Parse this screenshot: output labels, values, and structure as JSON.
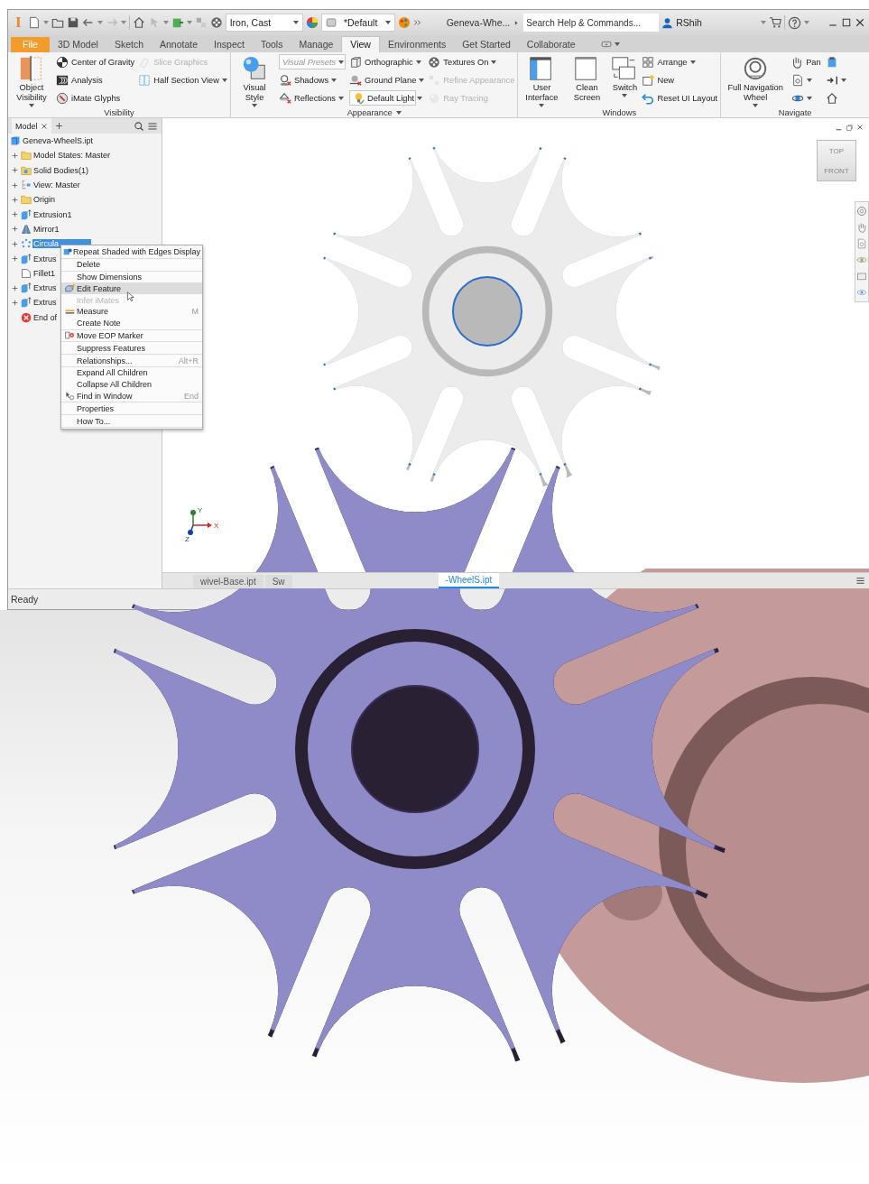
{
  "title_bar": {
    "logo": "I",
    "material": "Iron, Cast",
    "appearance": "*Default",
    "document": "Geneva-Whe...",
    "search": {
      "placeholder": "Search Help & Commands..."
    },
    "user": "RShih"
  },
  "ribbon_tabs": [
    {
      "label": "File",
      "kind": "file",
      "selected": false
    },
    {
      "label": "3D Model",
      "kind": "tab",
      "selected": false
    },
    {
      "label": "Sketch",
      "kind": "tab",
      "selected": false
    },
    {
      "label": "Annotate",
      "kind": "tab",
      "selected": false
    },
    {
      "label": "Inspect",
      "kind": "tab",
      "selected": false
    },
    {
      "label": "Tools",
      "kind": "tab",
      "selected": false
    },
    {
      "label": "Manage",
      "kind": "tab",
      "selected": false
    },
    {
      "label": "View",
      "kind": "tab",
      "selected": true
    },
    {
      "label": "Environments",
      "kind": "tab",
      "selected": false
    },
    {
      "label": "Get Started",
      "kind": "tab",
      "selected": false
    },
    {
      "label": "Collaborate",
      "kind": "tab",
      "selected": false
    }
  ],
  "ribbon_panels": [
    {
      "title": "Visibility",
      "title_dropdown": false,
      "columns": [
        [
          {
            "kind": "large",
            "label": "Object Visibility",
            "dropdown": true,
            "disabled": false
          }
        ],
        [
          {
            "kind": "small",
            "label": "Center of Gravity",
            "dropdown": false,
            "disabled": false
          },
          {
            "kind": "small",
            "label": "Analysis",
            "dropdown": false,
            "disabled": false
          },
          {
            "kind": "small",
            "label": "iMate Glyphs",
            "dropdown": false,
            "disabled": false
          }
        ],
        [
          {
            "kind": "small",
            "label": "Slice Graphics",
            "dropdown": false,
            "disabled": true
          },
          {
            "kind": "small",
            "label": "Half Section View",
            "dropdown": true,
            "disabled": false
          }
        ]
      ]
    },
    {
      "title": "Appearance",
      "title_dropdown": true,
      "columns": [
        [
          {
            "kind": "large",
            "label": "Visual Style",
            "dropdown": true,
            "disabled": false
          }
        ],
        [
          {
            "kind": "combo",
            "placeholder": "Visual Presets"
          },
          {
            "kind": "small",
            "label": "Shadows",
            "dropdown": true,
            "disabled": false
          },
          {
            "kind": "small",
            "label": "Reflections",
            "dropdown": true,
            "disabled": false
          }
        ],
        [
          {
            "kind": "small",
            "label": "Orthographic",
            "dropdown": true,
            "disabled": false
          },
          {
            "kind": "small",
            "label": "Ground Plane",
            "dropdown": true,
            "disabled": false
          },
          {
            "kind": "combo",
            "value": "Default Light"
          }
        ],
        [
          {
            "kind": "small",
            "label": "Textures On",
            "dropdown": true,
            "disabled": false
          },
          {
            "kind": "small",
            "label": "Refine Appearance",
            "dropdown": false,
            "disabled": true
          },
          {
            "kind": "small",
            "label": "Ray Tracing",
            "dropdown": false,
            "disabled": true
          }
        ]
      ]
    },
    {
      "title": "Windows",
      "title_dropdown": false,
      "columns": [
        [
          {
            "kind": "large",
            "label": "User Interface",
            "dropdown": true,
            "disabled": false
          }
        ],
        [
          {
            "kind": "large",
            "label": "Clean Screen",
            "dropdown": false,
            "disabled": false
          }
        ],
        [
          {
            "kind": "large",
            "label": "Switch",
            "dropdown": true,
            "disabled": false
          }
        ],
        [
          {
            "kind": "small",
            "label": "Arrange",
            "dropdown": true,
            "disabled": false
          },
          {
            "kind": "small",
            "label": "New",
            "dropdown": false,
            "disabled": false
          },
          {
            "kind": "small",
            "label": "Reset UI Layout",
            "dropdown": false,
            "disabled": false
          }
        ]
      ]
    },
    {
      "title": "Navigate",
      "title_dropdown": false,
      "columns": [
        [
          {
            "kind": "large",
            "label": "Full Navigation Wheel",
            "dropdown": true,
            "disabled": false
          }
        ],
        [
          {
            "kind": "small",
            "label": "Pan",
            "dropdown": false,
            "disabled": false
          },
          {
            "kind": "icon",
            "dropdown": true,
            "disabled": false
          },
          {
            "kind": "icon",
            "dropdown": true,
            "disabled": false
          }
        ],
        [
          {
            "kind": "icon",
            "dropdown": false,
            "disabled": false
          },
          {
            "kind": "icon",
            "dropdown": true,
            "disabled": false
          },
          {
            "kind": "icon",
            "dropdown": false,
            "disabled": false
          }
        ]
      ]
    }
  ],
  "browser": {
    "tab": "Model",
    "root": {
      "label": "Geneva-WheelS.ipt",
      "children": [
        {
          "label": "Model States: Master",
          "kind": "node",
          "selected": false
        },
        {
          "label": "Solid Bodies(1)",
          "kind": "node",
          "selected": false
        },
        {
          "label": "View: Master",
          "kind": "node",
          "selected": false
        },
        {
          "label": "Origin",
          "kind": "node",
          "selected": false
        },
        {
          "label": "Extrusion1",
          "kind": "node",
          "selected": false
        },
        {
          "label": "Mirror1",
          "kind": "node",
          "selected": false
        },
        {
          "label": "Circula",
          "kind": "node",
          "selected": true
        },
        {
          "label": "Extrus",
          "kind": "node",
          "selected": false
        },
        {
          "label": "Fillet1",
          "kind": "leaf",
          "selected": false
        },
        {
          "label": "Extrus",
          "kind": "node",
          "selected": false
        },
        {
          "label": "Extrus",
          "kind": "node",
          "selected": false
        },
        {
          "label": "End of",
          "kind": "leaf",
          "selected": false
        }
      ]
    }
  },
  "context_menu": {
    "groups": [
      [
        {
          "label": "Repeat Shaded with Edges Display",
          "selected": false,
          "disabled": false
        }
      ],
      [
        {
          "label": "Delete",
          "selected": false,
          "disabled": false
        }
      ],
      [
        {
          "label": "Show Dimensions",
          "selected": false,
          "disabled": false
        },
        {
          "label": "Edit Feature",
          "selected": true,
          "disabled": false
        },
        {
          "label": "Infer iMates",
          "selected": false,
          "disabled": true
        },
        {
          "label": "Measure",
          "shortcut": "M",
          "selected": false,
          "disabled": false
        },
        {
          "label": "Create Note",
          "selected": false,
          "disabled": false
        }
      ],
      [
        {
          "label": "Move EOP Marker",
          "selected": false,
          "disabled": false
        }
      ],
      [
        {
          "label": "Suppress Features",
          "selected": false,
          "disabled": false
        }
      ],
      [
        {
          "label": "Relationships...",
          "shortcut": "Alt+R",
          "selected": false,
          "disabled": false
        }
      ],
      [
        {
          "label": "Expand All Children",
          "selected": false,
          "disabled": false
        },
        {
          "label": "Collapse All Children",
          "selected": false,
          "disabled": false
        },
        {
          "label": "Find in Window",
          "shortcut": "End",
          "selected": false,
          "disabled": false
        }
      ],
      [
        {
          "label": "Properties",
          "selected": false,
          "disabled": false
        }
      ],
      [
        {
          "label": "How To...",
          "selected": false,
          "disabled": false
        }
      ]
    ]
  },
  "viewport": {
    "view_cube": {
      "top": "TOP",
      "front": "FRONT"
    },
    "axes": {
      "x": "X",
      "y": "Y",
      "z": "Z"
    },
    "document_tabs": [
      {
        "label": "wivel-Base.ipt",
        "selected": false
      },
      {
        "label": "Sw",
        "selected": false
      },
      {
        "label": "-WheelS.ipt",
        "selected": true
      }
    ]
  },
  "status_bar": {
    "text": "Ready"
  }
}
